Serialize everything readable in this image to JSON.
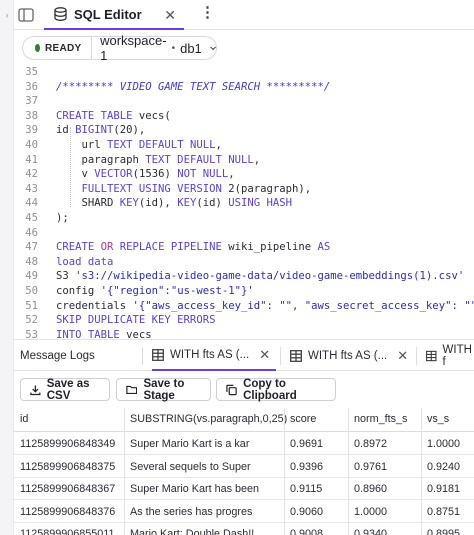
{
  "header": {
    "tab_title": "SQL Editor",
    "close_symbol": "✕",
    "menu_symbol": "⋮"
  },
  "workspace": {
    "status": "READY",
    "status_color": "#2e7d32",
    "name": "workspace-1",
    "separator": "•",
    "database": "db1"
  },
  "editor": {
    "lines": [
      {
        "n": "35",
        "segs": []
      },
      {
        "n": "36",
        "segs": [
          {
            "t": "/******** VIDEO GAME TEXT SEARCH *********/",
            "c": "cm"
          }
        ]
      },
      {
        "n": "37",
        "segs": []
      },
      {
        "n": "38",
        "segs": [
          {
            "t": "CREATE TABLE ",
            "c": "kw"
          },
          {
            "t": "vecs(",
            "c": ""
          }
        ]
      },
      {
        "n": "39",
        "segs": [
          {
            "t": "id ",
            "c": ""
          },
          {
            "t": "BIGINT",
            "c": "kw"
          },
          {
            "t": "(20),",
            "c": ""
          }
        ]
      },
      {
        "n": "40",
        "segs": [
          {
            "t": "    url ",
            "c": ""
          },
          {
            "t": "TEXT DEFAULT NULL",
            "c": "kw"
          },
          {
            "t": ",",
            "c": ""
          }
        ]
      },
      {
        "n": "41",
        "segs": [
          {
            "t": "    paragraph ",
            "c": ""
          },
          {
            "t": "TEXT DEFAULT NULL",
            "c": "kw"
          },
          {
            "t": ",",
            "c": ""
          }
        ]
      },
      {
        "n": "42",
        "segs": [
          {
            "t": "    v ",
            "c": ""
          },
          {
            "t": "VECTOR",
            "c": "kw"
          },
          {
            "t": "(1536) ",
            "c": ""
          },
          {
            "t": "NOT NULL",
            "c": "kw"
          },
          {
            "t": ",",
            "c": ""
          }
        ]
      },
      {
        "n": "43",
        "segs": [
          {
            "t": "    ",
            "c": ""
          },
          {
            "t": "FULLTEXT USING VERSION ",
            "c": "kw"
          },
          {
            "t": "2(paragraph),",
            "c": ""
          }
        ]
      },
      {
        "n": "44",
        "segs": [
          {
            "t": "    SHARD ",
            "c": ""
          },
          {
            "t": "KEY",
            "c": "kw"
          },
          {
            "t": "(id), ",
            "c": ""
          },
          {
            "t": "KEY",
            "c": "kw"
          },
          {
            "t": "(id) ",
            "c": ""
          },
          {
            "t": "USING HASH",
            "c": "kw"
          }
        ]
      },
      {
        "n": "45",
        "segs": [
          {
            "t": ");",
            "c": ""
          }
        ]
      },
      {
        "n": "46",
        "segs": []
      },
      {
        "n": "47",
        "segs": [
          {
            "t": "CREATE ",
            "c": "kw"
          },
          {
            "t": "OR ",
            "c": "tw"
          },
          {
            "t": "REPLACE PIPELINE ",
            "c": "kw"
          },
          {
            "t": "wiki_pipeline ",
            "c": ""
          },
          {
            "t": "AS",
            "c": "kw"
          }
        ]
      },
      {
        "n": "48",
        "segs": [
          {
            "t": "load data",
            "c": "kw"
          }
        ]
      },
      {
        "n": "49",
        "segs": [
          {
            "t": "S3 ",
            "c": ""
          },
          {
            "t": "'s3://wikipedia-video-game-data/video-game-embeddings(1).csv'",
            "c": "st"
          }
        ]
      },
      {
        "n": "50",
        "segs": [
          {
            "t": "config ",
            "c": ""
          },
          {
            "t": "'{\"region\":\"us-west-1\"}'",
            "c": "st"
          }
        ]
      },
      {
        "n": "51",
        "segs": [
          {
            "t": "credentials ",
            "c": ""
          },
          {
            "t": "'{\"aws_access_key_id\": \"\", \"aws_secret_access_key\": \"\"}'",
            "c": "st"
          }
        ]
      },
      {
        "n": "52",
        "segs": [
          {
            "t": "SKIP DUPLICATE KEY ERRORS",
            "c": "kw"
          }
        ]
      },
      {
        "n": "53",
        "segs": [
          {
            "t": "INTO TABLE ",
            "c": "kw"
          },
          {
            "t": "vecs",
            "c": ""
          }
        ]
      }
    ]
  },
  "results": {
    "tabs": [
      {
        "label": "Message Logs"
      },
      {
        "label": "WITH fts AS (...",
        "active": true
      },
      {
        "label": "WITH fts AS (..."
      },
      {
        "label": "WITH f"
      }
    ],
    "toolbar": {
      "save_csv": "Save as CSV",
      "save_stage": "Save to Stage",
      "copy_clipboard": "Copy to Clipboard"
    },
    "columns": [
      "id",
      "SUBSTRING(vs.paragraph,0,25)",
      "score",
      "norm_fts_s",
      "vs_s"
    ],
    "rows": [
      [
        "1125899906848349",
        "Super Mario Kart is a kar",
        "0.9691",
        "0.8972",
        "1.0000"
      ],
      [
        "1125899906848375",
        "Several sequels to Super",
        "0.9396",
        "0.9761",
        "0.9240"
      ],
      [
        "1125899906848367",
        "Super Mario Kart has been",
        "0.9115",
        "0.8960",
        "0.9181"
      ],
      [
        "1125899906848376",
        "As the series has progres",
        "0.9060",
        "1.0000",
        "0.8751"
      ],
      [
        "1125899906855011",
        "Mario Kart: Double Dash!!",
        "0.9008",
        "0.9340",
        "0.8995"
      ]
    ]
  }
}
